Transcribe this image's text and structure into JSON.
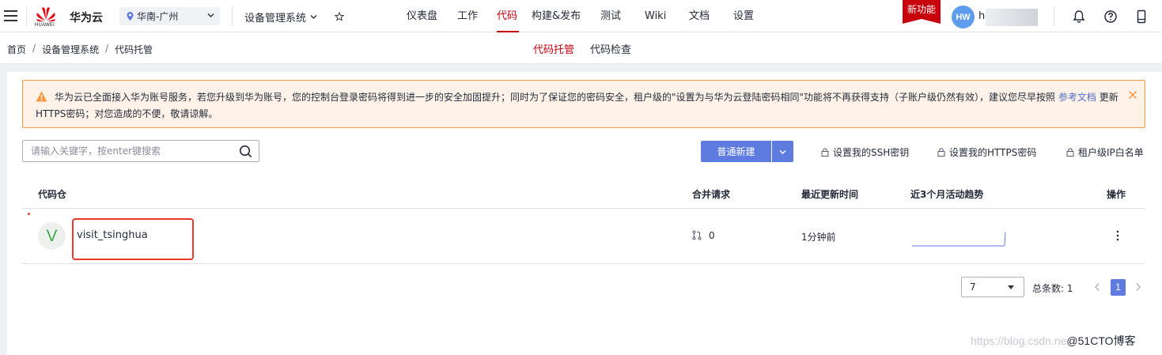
{
  "topbar": {
    "logo_text": "HUAWEI",
    "brand": "华为云",
    "region": "华南-广州",
    "service": "设备管理系统",
    "nav": [
      "仪表盘",
      "工作",
      "代码",
      "构建&发布",
      "测试",
      "Wiki",
      "文档",
      "设置"
    ],
    "active_nav": "代码",
    "new_feature": "新功能",
    "avatar": "HW",
    "username": "h"
  },
  "subbar": {
    "breadcrumb": [
      "首页",
      "设备管理系统",
      "代码托管"
    ],
    "tabs": [
      "代码托管",
      "代码检查"
    ],
    "active_tab": "代码托管"
  },
  "alert": {
    "text_before": "华为云已全面接入华为账号服务，若您升级到华为账号，您的控制台登录密码将得到进一步的安全加固提升；同时为了保证您的密码安全，租户级的\"设置为与华为云登陆密码相同\"功能将不再获得支持（子账户级仍然有效），建议您尽早按照 ",
    "link": "参考文档",
    "text_after": " 更新HTTPS密码；对您造成的不便，敬请谅解。"
  },
  "toolbar": {
    "search_placeholder": "请输入关键字，按enter键搜索",
    "new_button": "普通新建",
    "ssh_link": "设置我的SSH密钥",
    "https_link": "设置我的HTTPS密码",
    "whitelist_link": "租户级IP白名单"
  },
  "table": {
    "headers": [
      "代码仓",
      "合并请求",
      "最近更新时间",
      "近3个月活动趋势",
      "操作"
    ],
    "rows": [
      {
        "avatar": "V",
        "name": "visit_tsinghua",
        "merge_requests": "0",
        "updated": "1分钟前"
      }
    ]
  },
  "pager": {
    "page_size": "7",
    "total": "总条数: 1",
    "current_page": "1"
  },
  "watermark": {
    "url": "https://blog.csdn.ne",
    "tag": "@51CTO博客"
  },
  "colors": {
    "brand_red": "#c7000b",
    "primary_blue": "#5e7ce0",
    "alert_border": "#fa9841",
    "alert_bg": "#fff3e9",
    "link_blue": "#526ecc"
  },
  "icons": [
    "menu-icon",
    "huawei-logo-icon",
    "location-pin-icon",
    "chevron-down-icon",
    "star-icon",
    "bell-icon",
    "help-icon",
    "mobile-icon",
    "warning-icon",
    "close-icon",
    "search-icon",
    "lock-icon",
    "merge-request-icon",
    "more-vertical-icon",
    "chevron-left-icon",
    "chevron-right-icon"
  ]
}
